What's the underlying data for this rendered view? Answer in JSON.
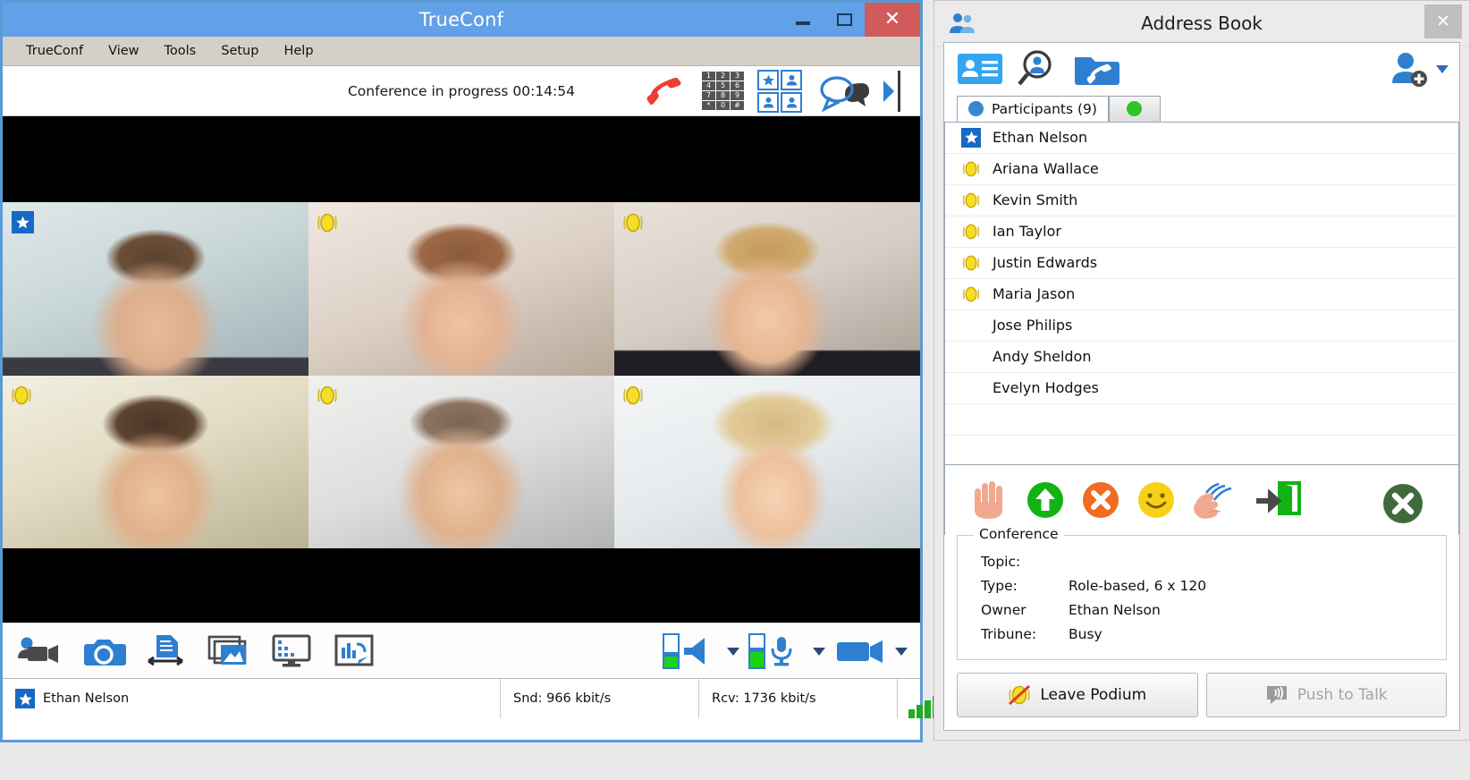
{
  "main_window": {
    "title": "TrueConf",
    "window_controls": {
      "minimize": "–",
      "maximize": "□",
      "close": "✕"
    },
    "menu": [
      {
        "label": "TrueConf"
      },
      {
        "label": "View"
      },
      {
        "label": "Tools"
      },
      {
        "label": "Setup"
      },
      {
        "label": "Help"
      }
    ],
    "conference_status": "Conference in progress 00:14:54",
    "conference_icons": [
      {
        "name": "hangup-phone-icon"
      },
      {
        "name": "dialpad-icon",
        "keys": [
          "1",
          "2",
          "3",
          "4",
          "5",
          "6",
          "7",
          "8",
          "9",
          "*",
          "0",
          "#"
        ]
      },
      {
        "name": "layout-grid-icon"
      },
      {
        "name": "chat-bubbles-icon"
      },
      {
        "name": "expand-panel-arrow-icon"
      }
    ],
    "video_tiles": [
      {
        "badge": "star"
      },
      {
        "badge": "mic"
      },
      {
        "badge": "mic"
      },
      {
        "badge": "mic"
      },
      {
        "badge": "mic"
      },
      {
        "badge": "mic"
      }
    ],
    "bottom_toolbar_left": [
      {
        "name": "record-video-icon"
      },
      {
        "name": "snapshot-camera-icon"
      },
      {
        "name": "file-transfer-icon"
      },
      {
        "name": "slideshow-icon"
      },
      {
        "name": "screen-share-icon"
      },
      {
        "name": "whiteboard-icon"
      }
    ],
    "bottom_toolbar_right": [
      {
        "name": "speaker-volume-icon"
      },
      {
        "name": "speaker-dropdown-caret"
      },
      {
        "name": "microphone-icon"
      },
      {
        "name": "microphone-dropdown-caret"
      },
      {
        "name": "camera-icon"
      },
      {
        "name": "camera-dropdown-caret"
      }
    ],
    "status_bar": {
      "user_name": "Ethan Nelson",
      "send_rate": "Snd: 966 kbit/s",
      "receive_rate": "Rcv: 1736 kbit/s",
      "signal_bars": 5,
      "security_icon": "shield-icon"
    }
  },
  "address_book": {
    "title": "Address Book",
    "close_label": "✕",
    "toolbar": [
      {
        "name": "contacts-card-icon"
      },
      {
        "name": "search-user-icon"
      },
      {
        "name": "call-history-icon"
      }
    ],
    "add_user_icon": "add-user-icon",
    "add_user_caret": "chevron-down-icon",
    "tabs": [
      {
        "label": "Participants (9)",
        "dot": "blue",
        "active": true
      },
      {
        "label": "",
        "dot": "green",
        "active": false
      }
    ],
    "participants": [
      {
        "name": "Ethan Nelson",
        "icon": "star"
      },
      {
        "name": "Ariana Wallace",
        "icon": "mic"
      },
      {
        "name": "Kevin Smith",
        "icon": "mic"
      },
      {
        "name": "Ian Taylor",
        "icon": "mic"
      },
      {
        "name": "Justin Edwards",
        "icon": "mic"
      },
      {
        "name": "Maria Jason",
        "icon": "mic"
      },
      {
        "name": "Jose Philips",
        "icon": "none"
      },
      {
        "name": "Andy Sheldon",
        "icon": "none"
      },
      {
        "name": "Evelyn Hodges",
        "icon": "none"
      },
      {
        "name": "",
        "icon": "none"
      },
      {
        "name": "",
        "icon": "none"
      }
    ],
    "action_icons": [
      {
        "name": "raise-hand-icon"
      },
      {
        "name": "grant-podium-up-icon"
      },
      {
        "name": "deny-podium-icon"
      },
      {
        "name": "smiley-icon"
      },
      {
        "name": "applause-icon"
      },
      {
        "name": "exit-door-icon"
      },
      {
        "name": "remove-all-icon"
      }
    ],
    "conference_group": {
      "legend": "Conference",
      "rows": [
        {
          "key": "Topic:",
          "value": ""
        },
        {
          "key": "Type:",
          "value": "Role-based, 6 x 120"
        },
        {
          "key": "Owner",
          "value": "Ethan Nelson"
        },
        {
          "key": "Tribune:",
          "value": "Busy"
        }
      ]
    },
    "buttons": [
      {
        "label": "Leave Podium",
        "icon": "leave-podium-icon",
        "disabled": false
      },
      {
        "label": "Push to Talk",
        "icon": "push-to-talk-icon",
        "disabled": true
      }
    ]
  },
  "colors": {
    "title_blue": "#62a0e8",
    "close_red": "#d15b5b",
    "menu_gray": "#d4d0c8",
    "accent_blue": "#2f7fd1",
    "green": "#22aa22",
    "dark_green": "#3f6b3c"
  }
}
